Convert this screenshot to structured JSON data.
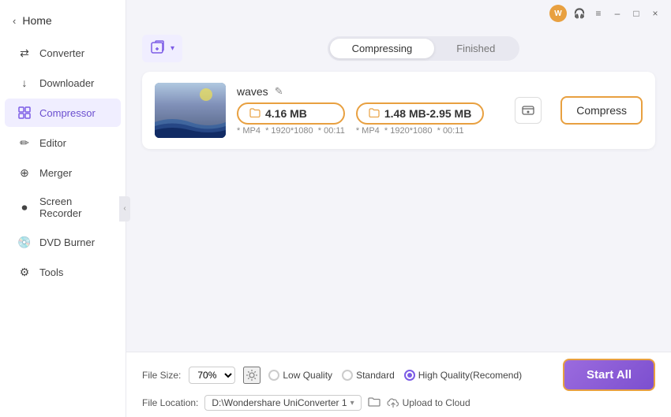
{
  "titlebar": {
    "avatar_initials": "W",
    "headset_icon": "🎧",
    "menu_icon": "≡",
    "minimize_icon": "–",
    "maximize_icon": "□",
    "close_icon": "×"
  },
  "sidebar": {
    "home_label": "Home",
    "items": [
      {
        "id": "converter",
        "label": "Converter",
        "icon": "⇄"
      },
      {
        "id": "downloader",
        "label": "Downloader",
        "icon": "↓"
      },
      {
        "id": "compressor",
        "label": "Compressor",
        "icon": "⊞",
        "active": true
      },
      {
        "id": "editor",
        "label": "Editor",
        "icon": "✏"
      },
      {
        "id": "merger",
        "label": "Merger",
        "icon": "⊕"
      },
      {
        "id": "screen-recorder",
        "label": "Screen Recorder",
        "icon": "⏺"
      },
      {
        "id": "dvd-burner",
        "label": "DVD Burner",
        "icon": "💿"
      },
      {
        "id": "tools",
        "label": "Tools",
        "icon": "⚙"
      }
    ]
  },
  "toolbar": {
    "add_button_label": "",
    "add_button_icon": "📄+"
  },
  "tabs": {
    "compressing_label": "Compressing",
    "finished_label": "Finished",
    "active": "compressing"
  },
  "file": {
    "name": "waves",
    "original_size": "4.16 MB",
    "compressed_size": "1.48 MB-2.95 MB",
    "format": "MP4",
    "resolution": "1920*1080",
    "duration": "00:11",
    "compress_button_label": "Compress"
  },
  "bottom": {
    "file_size_label": "File Size:",
    "file_size_value": "70%",
    "quality_options": [
      "Low Quality",
      "Standard",
      "High Quality(Recomend)"
    ],
    "selected_quality": "High Quality(Recomend)",
    "file_location_label": "File Location:",
    "location_path": "D:\\Wondershare UniConverter 1",
    "upload_cloud_label": "Upload to Cloud",
    "start_all_label": "Start All"
  }
}
